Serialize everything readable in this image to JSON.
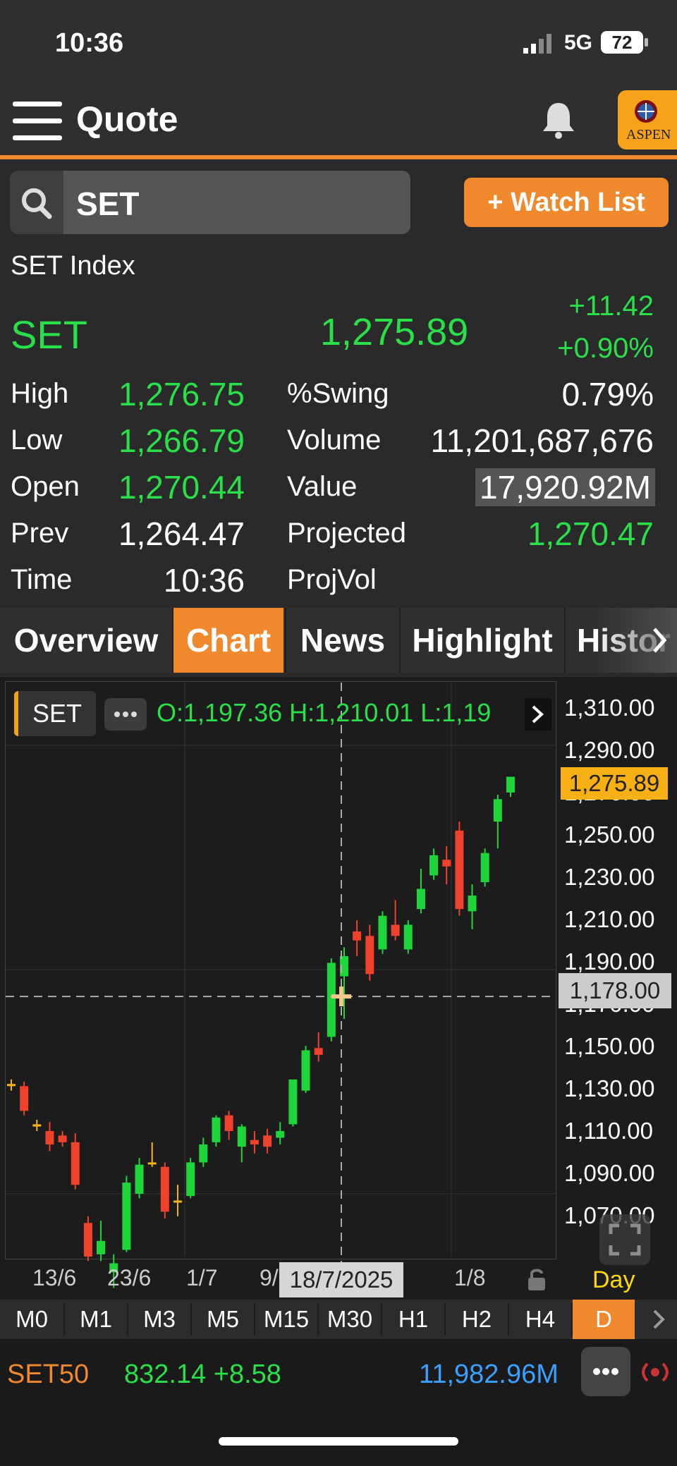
{
  "status": {
    "time": "10:36",
    "network": "5G",
    "battery": "72"
  },
  "header": {
    "title": "Quote",
    "logo_text": "ASPEN"
  },
  "search": {
    "value": "SET",
    "watch_button": "+ Watch List"
  },
  "quote": {
    "name": "SET Index",
    "symbol": "SET",
    "last": "1,275.89",
    "change": "+11.42",
    "change_pct": "+0.90%",
    "rows": {
      "high_label": "High",
      "high": "1,276.75",
      "low_label": "Low",
      "low": "1,266.79",
      "open_label": "Open",
      "open": "1,270.44",
      "prev_label": "Prev",
      "prev": "1,264.47",
      "time_label": "Time",
      "time": "10:36",
      "swing_label": "%Swing",
      "swing": "0.79%",
      "volume_label": "Volume",
      "volume": "11,201,687,676",
      "value_label": "Value",
      "value": "17,920.92M",
      "projected_label": "Projected",
      "projected": "1,270.47",
      "projvol_label": "ProjVol"
    }
  },
  "tabs": [
    "Overview",
    "Chart",
    "News",
    "Highlight",
    "Histor"
  ],
  "chart_header": {
    "symbol": "SET",
    "ohlc": "O:1,197.36  H:1,210.01  L:1,19"
  },
  "chart_data": {
    "type": "candlestick",
    "y_ticks": [
      "1,310.00",
      "1,290.00",
      "1,270.00",
      "1,250.00",
      "1,230.00",
      "1,210.00",
      "1,190.00",
      "1,170.00",
      "1,150.00",
      "1,130.00",
      "1,110.00",
      "1,090.00",
      "1,070.00"
    ],
    "ylim": [
      1062,
      1318
    ],
    "x_ticks": [
      "13/6",
      "23/6",
      "1/7",
      "9/",
      "1/8"
    ],
    "last_price_label": "1,275.89",
    "crosshair_price_label": "1,178.00",
    "crosshair_date_label": "18/7/2025",
    "period_label": "Day",
    "colors": {
      "up": "#1ed63c",
      "down": "#f0412c",
      "neutral": "#f5b31a"
    },
    "candles": [
      {
        "o": 1139,
        "h": 1141,
        "l": 1136,
        "c": 1138
      },
      {
        "o": 1138,
        "h": 1140,
        "l": 1125,
        "c": 1127
      },
      {
        "o": 1121,
        "h": 1123,
        "l": 1118,
        "c": 1120
      },
      {
        "o": 1118,
        "h": 1122,
        "l": 1109,
        "c": 1112
      },
      {
        "o": 1116,
        "h": 1118,
        "l": 1111,
        "c": 1113
      },
      {
        "o": 1113,
        "h": 1117,
        "l": 1092,
        "c": 1094
      },
      {
        "o": 1077,
        "h": 1080,
        "l": 1060,
        "c": 1062
      },
      {
        "o": 1063,
        "h": 1078,
        "l": 1060,
        "c": 1069
      },
      {
        "o": 1055,
        "h": 1063,
        "l": 1048,
        "c": 1059
      },
      {
        "o": 1065,
        "h": 1098,
        "l": 1064,
        "c": 1095
      },
      {
        "o": 1090,
        "h": 1106,
        "l": 1088,
        "c": 1103
      },
      {
        "o": 1104,
        "h": 1113,
        "l": 1102,
        "c": 1104
      },
      {
        "o": 1102,
        "h": 1104,
        "l": 1079,
        "c": 1082
      },
      {
        "o": 1087,
        "h": 1094,
        "l": 1080,
        "c": 1087
      },
      {
        "o": 1089,
        "h": 1106,
        "l": 1088,
        "c": 1104
      },
      {
        "o": 1104,
        "h": 1115,
        "l": 1102,
        "c": 1112
      },
      {
        "o": 1113,
        "h": 1125,
        "l": 1111,
        "c": 1124
      },
      {
        "o": 1125,
        "h": 1127,
        "l": 1114,
        "c": 1118
      },
      {
        "o": 1111,
        "h": 1121,
        "l": 1104,
        "c": 1120
      },
      {
        "o": 1114,
        "h": 1118,
        "l": 1108,
        "c": 1112
      },
      {
        "o": 1116,
        "h": 1119,
        "l": 1108,
        "c": 1111
      },
      {
        "o": 1115,
        "h": 1122,
        "l": 1112,
        "c": 1118
      },
      {
        "o": 1121,
        "h": 1132,
        "l": 1120,
        "c": 1141
      },
      {
        "o": 1136,
        "h": 1156,
        "l": 1135,
        "c": 1154
      },
      {
        "o": 1155,
        "h": 1162,
        "l": 1149,
        "c": 1152
      },
      {
        "o": 1160,
        "h": 1195,
        "l": 1158,
        "c": 1193
      },
      {
        "o": 1187,
        "h": 1200,
        "l": 1168,
        "c": 1196
      },
      {
        "o": 1207,
        "h": 1212,
        "l": 1196,
        "c": 1203
      },
      {
        "o": 1205,
        "h": 1210,
        "l": 1185,
        "c": 1188
      },
      {
        "o": 1199,
        "h": 1216,
        "l": 1197,
        "c": 1214
      },
      {
        "o": 1210,
        "h": 1221,
        "l": 1203,
        "c": 1205
      },
      {
        "o": 1199,
        "h": 1212,
        "l": 1197,
        "c": 1210
      },
      {
        "o": 1217,
        "h": 1235,
        "l": 1215,
        "c": 1226
      },
      {
        "o": 1232,
        "h": 1244,
        "l": 1230,
        "c": 1241
      },
      {
        "o": 1239,
        "h": 1245,
        "l": 1228,
        "c": 1236
      },
      {
        "o": 1252,
        "h": 1256,
        "l": 1214,
        "c": 1217
      },
      {
        "o": 1216,
        "h": 1228,
        "l": 1208,
        "c": 1223
      },
      {
        "o": 1229,
        "h": 1244,
        "l": 1227,
        "c": 1242
      },
      {
        "o": 1256,
        "h": 1268,
        "l": 1244,
        "c": 1266
      },
      {
        "o": 1269,
        "h": 1276,
        "l": 1267,
        "c": 1276
      }
    ]
  },
  "intervals": [
    "M0",
    "M1",
    "M3",
    "M5",
    "M15",
    "M30",
    "H1",
    "H2",
    "H4",
    "D"
  ],
  "ticker": {
    "symbol": "SET50",
    "value_change": "832.14 +8.58",
    "traded_value": "11,982.96M"
  }
}
